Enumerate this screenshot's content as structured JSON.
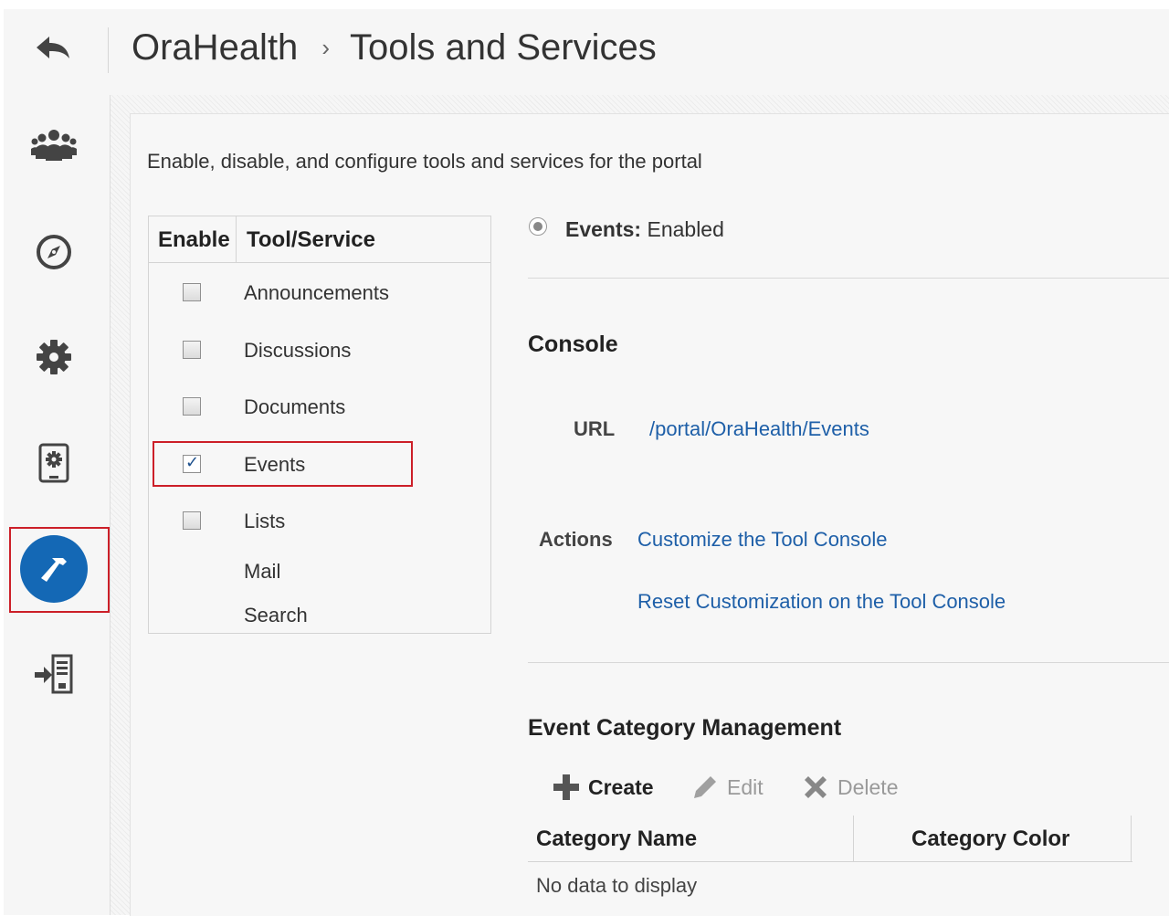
{
  "header": {
    "breadcrumb_parent": "OraHealth",
    "breadcrumb_separator": "›",
    "breadcrumb_current": "Tools and Services"
  },
  "rail": {
    "items": [
      {
        "icon": "back-arrow-icon"
      },
      {
        "icon": "people-icon"
      },
      {
        "icon": "compass-icon"
      },
      {
        "icon": "gear-icon"
      },
      {
        "icon": "device-settings-icon"
      },
      {
        "icon": "hammer-icon",
        "active": true
      },
      {
        "icon": "sign-in-icon"
      }
    ],
    "active_color": "#1468b5",
    "highlight_color": "#cc1f28"
  },
  "intro": "Enable, disable, and configure tools and services for the portal",
  "tools_table": {
    "col_enable": "Enable",
    "col_tool": "Tool/Service",
    "rows": [
      {
        "name": "Announcements",
        "checked": false,
        "has_checkbox": true
      },
      {
        "name": "Discussions",
        "checked": false,
        "has_checkbox": true
      },
      {
        "name": "Documents",
        "checked": false,
        "has_checkbox": true
      },
      {
        "name": "Events",
        "checked": true,
        "has_checkbox": true
      },
      {
        "name": "Lists",
        "checked": false,
        "has_checkbox": true
      },
      {
        "name": "Mail",
        "has_checkbox": false
      },
      {
        "name": "Search",
        "has_checkbox": false
      }
    ]
  },
  "detail": {
    "status_label": "Events:",
    "status_value": "Enabled",
    "console": {
      "title": "Console",
      "url_label": "URL",
      "url_value": "/portal/OraHealth/Events",
      "actions_label": "Actions",
      "action_customize": "Customize the Tool Console",
      "action_reset": "Reset Customization on the Tool Console"
    },
    "event_category": {
      "title": "Event Category Management",
      "create": "Create",
      "edit": "Edit",
      "delete": "Delete",
      "col_name": "Category Name",
      "col_color": "Category Color",
      "empty": "No data to display"
    }
  },
  "colors": {
    "link": "#1e5fa8",
    "accent": "#1468b5"
  }
}
